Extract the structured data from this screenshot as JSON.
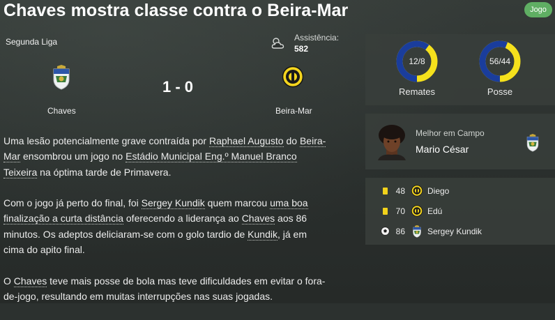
{
  "header": {
    "title": "Chaves mostra classe contra o Beira-Mar",
    "badge": "Jogo"
  },
  "match": {
    "competition": "Segunda Liga",
    "attendance_label": "Assistência:",
    "attendance_value": "582",
    "weather_icon": "cloudy-icon",
    "score": "1 - 0",
    "home_team": "Chaves",
    "away_team": "Beira-Mar"
  },
  "article": {
    "p1": {
      "t1": "Uma lesão potencialmente grave contraída por ",
      "l1": "Raphael Augusto",
      "t2": " do ",
      "l2": "Beira-Mar",
      "t3": " ensombrou um jogo no ",
      "l3": "Estádio Municipal Eng.º Manuel Branco Teixeira",
      "t4": " na óptima tarde de Primavera."
    },
    "p2": {
      "t1": "Com o jogo já perto do final, foi ",
      "l1": "Sergey Kundik",
      "t2": " quem marcou ",
      "l2": "uma boa finalização a curta distância",
      "t3": " oferecendo a liderança ao ",
      "l3": "Chaves",
      "t4": " aos 86 minutos. Os adeptos deliciaram-se com o golo tardio de ",
      "l4": "Kundik",
      "t5": ", já em cima do apito final."
    },
    "p3": {
      "t1": "O ",
      "l1": "Chaves",
      "t2": " teve mais posse de bola mas teve dificuldades em evitar o fora-de-jogo, resultando em muitas interrupções nas suas jogadas."
    }
  },
  "stats": {
    "shots": {
      "label": "Remates",
      "value": "12/8",
      "home": 12,
      "away": 8
    },
    "possession": {
      "label": "Posse",
      "value": "56/44",
      "home": 56,
      "away": 44
    },
    "colors": {
      "home": "#1a3d9c",
      "away": "#f5e11c"
    }
  },
  "motm": {
    "label": "Melhor em Campo",
    "name": "Mario César"
  },
  "events": [
    {
      "icon": "yellow-card-icon",
      "minute": "48",
      "player": "Diego",
      "team": "Beira-Mar"
    },
    {
      "icon": "yellow-card-icon",
      "minute": "70",
      "player": "Edú",
      "team": "Beira-Mar"
    },
    {
      "icon": "football-goal-icon",
      "minute": "86",
      "player": "Sergey Kundik",
      "team": "Chaves"
    }
  ]
}
